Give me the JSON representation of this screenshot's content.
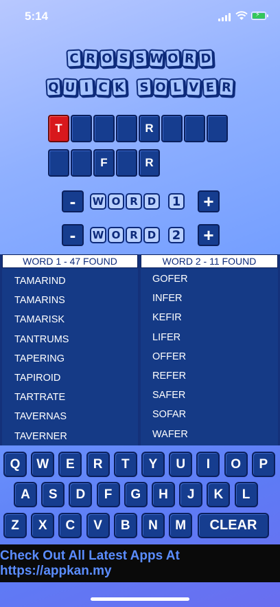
{
  "status": {
    "time": "5:14"
  },
  "title": {
    "line1": [
      "C",
      "R",
      "O",
      "S",
      "S",
      "W",
      "O",
      "R",
      "D"
    ],
    "line2": [
      "Q",
      "U",
      "I",
      "C",
      "K",
      " ",
      "S",
      "O",
      "L",
      "V",
      "E",
      "R"
    ]
  },
  "word1": {
    "cells": [
      "T",
      "",
      "",
      "",
      "R",
      "",
      "",
      ""
    ],
    "active_index": 0
  },
  "word2": {
    "cells": [
      "",
      "",
      "F",
      "",
      "R"
    ]
  },
  "word1_control": {
    "minus": "-",
    "label": [
      "W",
      "O",
      "R",
      "D"
    ],
    "number": "1",
    "plus": "+"
  },
  "word2_control": {
    "minus": "-",
    "label": [
      "W",
      "O",
      "R",
      "D"
    ],
    "number": "2",
    "plus": "+"
  },
  "results": {
    "list1": {
      "header": "WORD 1 - 47 FOUND",
      "items": [
        "TAMARIND",
        "TAMARINS",
        "TAMARISK",
        "TANTRUMS",
        "TAPERING",
        "TAPIROID",
        "TARTRATE",
        "TAVERNAS",
        "TAVERNER"
      ]
    },
    "list2": {
      "header": "WORD 2 - 11 FOUND",
      "items": [
        "GOFER",
        "INFER",
        "KEFIR",
        "LIFER",
        "OFFER",
        "REFER",
        "SAFER",
        "SOFAR",
        "WAFER"
      ]
    }
  },
  "keyboard": {
    "row1": [
      "Q",
      "W",
      "E",
      "R",
      "T",
      "Y",
      "U",
      "I",
      "O",
      "P"
    ],
    "row2": [
      "A",
      "S",
      "D",
      "F",
      "G",
      "H",
      "J",
      "K",
      "L"
    ],
    "row3": [
      "Z",
      "X",
      "C",
      "V",
      "B",
      "N",
      "M"
    ],
    "clear": "CLEAR"
  },
  "banner": {
    "text": "Check Out All Latest Apps At https://appkan.my"
  }
}
